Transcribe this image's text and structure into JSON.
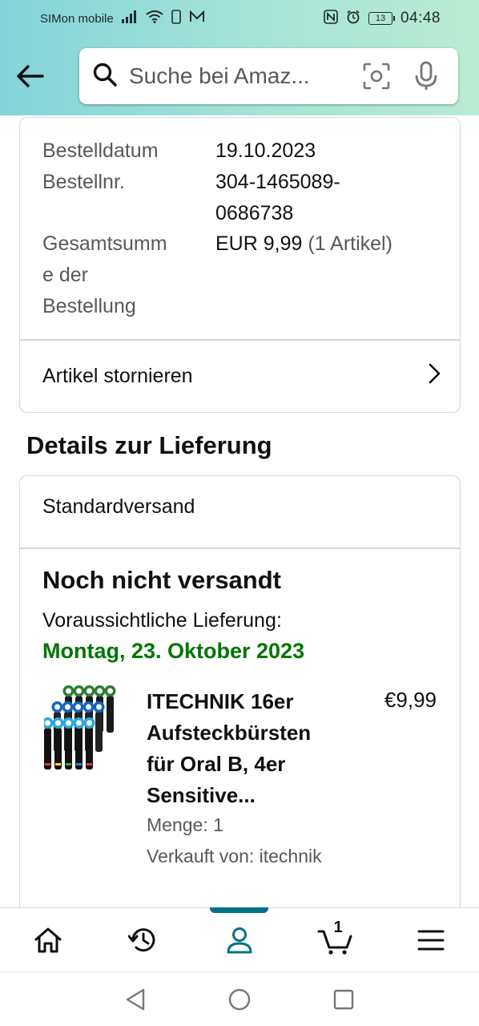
{
  "status_bar": {
    "carrier": "SIMon mobile",
    "battery": "13",
    "time": "04:48"
  },
  "search": {
    "placeholder": "Suche bei Amaz..."
  },
  "order_summary": {
    "order_date_label": "Bestelldatum",
    "order_date_value": "19.10.2023",
    "order_number_label": "Bestellnr.",
    "order_number_value_line1": "304-1465089-",
    "order_number_value_line2": "0686738",
    "total_label_line1": "Gesamtsumm",
    "total_label_line2": "e der",
    "total_label_line3": "Bestellung",
    "total_amount": "EUR 9,99",
    "total_items": "(1 Artikel)",
    "cancel_label": "Artikel stornieren"
  },
  "delivery": {
    "section_title": "Details zur Lieferung",
    "shipping_method": "Standardversand",
    "status": "Noch nicht versandt",
    "expected_label": "Voraussichtliche Lieferung:",
    "expected_date": "Montag, 23. Oktober 2023",
    "date_color": "#007600"
  },
  "product": {
    "title_line1": "ITECHNIK 16er",
    "title_line2": "Aufsteckbürsten",
    "title_line3": "für Oral B, 4er",
    "title_line4": "Sensitive...",
    "price": "€9,99",
    "quantity": "Menge: 1",
    "seller": "Verkauft von: itechnik"
  },
  "bottom_nav": {
    "items": [
      "home-icon",
      "history-icon",
      "account-icon",
      "cart-icon",
      "menu-icon"
    ],
    "active": "account-icon",
    "cart_count": "1",
    "accent_color": "#007185"
  }
}
